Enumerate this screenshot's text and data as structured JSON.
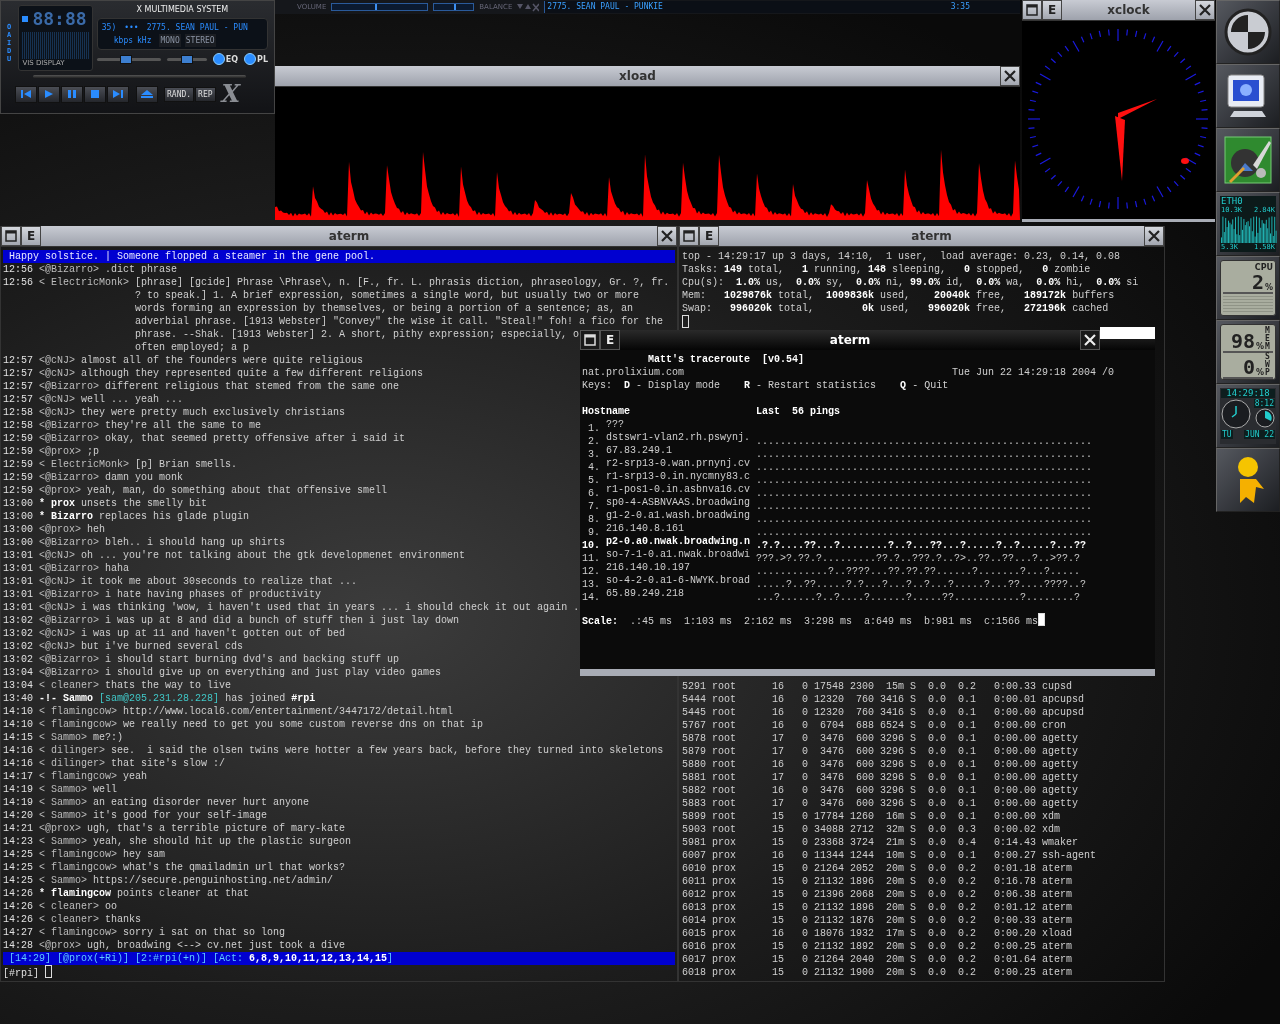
{
  "xmms": {
    "side_label": "OAIDU",
    "time": "88:88",
    "vis_label": "VIS DISPLAY",
    "title": "X MULTIMEDIA SYSTEM",
    "track_number": "35)",
    "dots": "•••",
    "track": "2775. SEAN PAUL - PUN",
    "bitrate_unit": "kbps",
    "rate_unit": "kHz",
    "modes": [
      {
        "label": "MONO",
        "on": false
      },
      {
        "label": "STEREO",
        "on": false
      }
    ],
    "volume": {
      "level": 0.45
    },
    "balance": {
      "level": 0.5
    },
    "toggles": [
      {
        "label": "EQ",
        "on": true
      },
      {
        "label": "PL",
        "on": true
      }
    ],
    "controls": [
      {
        "kind": "previous"
      },
      {
        "kind": "play"
      },
      {
        "kind": "pause"
      },
      {
        "kind": "stop"
      },
      {
        "kind": "next"
      },
      {
        "kind": "eject"
      }
    ],
    "options": [
      {
        "label": "RAND."
      },
      {
        "label": "REP"
      }
    ],
    "logo": "X"
  },
  "playlist_bar": {
    "volume_label": "VOLUME",
    "volume": {
      "level": 0.45
    },
    "balance_label": "BALANCE",
    "balance": {
      "level": 0.5
    },
    "track": "2775. SEAN PAUL - PUNKIE",
    "time": "3:35"
  },
  "xload": {
    "title": "xload"
  },
  "xclock": {
    "title": "xclock",
    "e_button": "E",
    "focused": false
  },
  "dock": [
    {
      "kind": "logo"
    },
    {
      "kind": "monitor"
    },
    {
      "kind": "paint"
    },
    {
      "kind": "network",
      "interface": "ETH0",
      "top_in": "10.3K",
      "top_out": "2.84K",
      "bottom_in": "5.3K",
      "bottom_out": "1.58K"
    },
    {
      "kind": "cpu",
      "label": "CPU",
      "value": "2",
      "unit": "%"
    },
    {
      "kind": "memory",
      "rows": [
        {
          "label": "MEM",
          "value": "98",
          "unit": "%"
        },
        {
          "label": "SWP",
          "value": "0",
          "unit": "%"
        }
      ]
    },
    {
      "kind": "clock",
      "time": "14:29:18",
      "small": "8:12",
      "day": "TU",
      "date": "JUN 22"
    },
    {
      "kind": "person"
    }
  ],
  "irc": {
    "title": "aterm",
    "e_button": "E",
    "focused": false,
    "topic": "Happy solstice. | Someone flopped a steamer in the gene pool.",
    "lines": [
      {
        "kind": "msg",
        "time": "12:56",
        "nick": "<@Bizarro>",
        "text": ".dict phrase"
      },
      {
        "kind": "msg",
        "time": "12:56",
        "nick": "< ElectricMonk>",
        "text": "[phrase] [gcide] Phrase \\Phrase\\, n. [F., fr. L. phrasis diction, phraseology, Gr. ?, fr."
      },
      {
        "kind": "cont",
        "text": "? to speak.] 1. A brief expression, sometimes a single word, but usually two or more"
      },
      {
        "kind": "cont",
        "text": "words forming an expression by themselves, or being a portion of a sentence; as, an"
      },
      {
        "kind": "cont",
        "text": "adverbial phrase. [1913 Webster] \"Convey\" the wise it call. \"Steal!\" foh! a fico for the"
      },
      {
        "kind": "cont",
        "text": "phrase. --Shak. [1913 Webster] 2. A short, pithy expression; especially, o"
      },
      {
        "kind": "cont",
        "text": "often employed; a p"
      },
      {
        "kind": "msg",
        "time": "12:57",
        "nick": "<@cNJ>",
        "text": "almost all of the founders were quite religious"
      },
      {
        "kind": "msg",
        "time": "12:57",
        "nick": "<@cNJ>",
        "text": "although they represented quite a few different religions"
      },
      {
        "kind": "msg",
        "time": "12:57",
        "nick": "<@Bizarro>",
        "text": "different religious that stemed from the same one"
      },
      {
        "kind": "msg",
        "time": "12:57",
        "nick": "<@cNJ>",
        "text": "well ... yeah ..."
      },
      {
        "kind": "msg",
        "time": "12:58",
        "nick": "<@cNJ>",
        "text": "they were pretty much exclusively christians"
      },
      {
        "kind": "msg",
        "time": "12:58",
        "nick": "<@Bizarro>",
        "text": "they're all the same to me"
      },
      {
        "kind": "msg",
        "time": "12:59",
        "nick": "<@Bizarro>",
        "text": "okay, that seemed pretty offensive after i said it"
      },
      {
        "kind": "msg",
        "time": "12:59",
        "nick": "<@prox>",
        "text": ";p"
      },
      {
        "kind": "msg",
        "time": "12:59",
        "nick": "< ElectricMonk>",
        "text": "[p] Brian smells."
      },
      {
        "kind": "msg",
        "time": "12:59",
        "nick": "<@Bizarro>",
        "text": "damn you monk"
      },
      {
        "kind": "msg",
        "time": "12:59",
        "nick": "<@prox>",
        "text": "yeah, man, do something about that offensive smell"
      },
      {
        "kind": "action",
        "time": "13:00",
        "marker": "*",
        "nick": "prox",
        "text": "unsets the smelly bit"
      },
      {
        "kind": "action",
        "time": "13:00",
        "marker": "*",
        "nick": "Bizarro",
        "text": "replaces his glade plugin"
      },
      {
        "kind": "msg",
        "time": "13:00",
        "nick": "<@prox>",
        "text": "heh"
      },
      {
        "kind": "msg",
        "time": "13:00",
        "nick": "<@Bizarro>",
        "text": "bleh.. i should hang up shirts"
      },
      {
        "kind": "msg",
        "time": "13:01",
        "nick": "<@cNJ>",
        "text": "oh ... you're not talking about the gtk developmenet environment"
      },
      {
        "kind": "msg",
        "time": "13:01",
        "nick": "<@Bizarro>",
        "text": "haha"
      },
      {
        "kind": "msg",
        "time": "13:01",
        "nick": "<@cNJ>",
        "text": "it took me about 30seconds to realize that ..."
      },
      {
        "kind": "msg",
        "time": "13:01",
        "nick": "<@Bizarro>",
        "text": "i hate having phases of productivity"
      },
      {
        "kind": "msg",
        "time": "13:01",
        "nick": "<@cNJ>",
        "text": "i was thinking 'wow, i haven't used that in years ... i should check it out again ."
      },
      {
        "kind": "msg",
        "time": "13:02",
        "nick": "<@Bizarro>",
        "text": "i was up at 8 and did a bunch of stuff then i just lay down"
      },
      {
        "kind": "msg",
        "time": "13:02",
        "nick": "<@cNJ>",
        "text": "i was up at 11 and haven't gotten out of bed"
      },
      {
        "kind": "msg",
        "time": "13:02",
        "nick": "<@cNJ>",
        "text": "but i've burned several cds"
      },
      {
        "kind": "msg",
        "time": "13:02",
        "nick": "<@Bizarro>",
        "text": "i should start burning dvd's and backing stuff up"
      },
      {
        "kind": "msg",
        "time": "13:04",
        "nick": "<@Bizarro>",
        "text": "i should give up on everything and just play video games"
      },
      {
        "kind": "msg",
        "time": "13:04",
        "nick": "< cleaner>",
        "text": "thats the way to live"
      },
      {
        "kind": "join",
        "time": "13:40",
        "marker": "-!-",
        "nick": "Sammo",
        "host": "[sam@205.231.28.228]",
        "text": "has joined",
        "channel": "#rpi"
      },
      {
        "kind": "msg",
        "time": "14:10",
        "nick": "< flamingcow>",
        "text": "http://www.local6.com/entertainment/3447172/detail.html"
      },
      {
        "kind": "msg",
        "time": "14:10",
        "nick": "< flamingcow>",
        "text": "we really need to get you some custom reverse dns on that ip"
      },
      {
        "kind": "msg",
        "time": "14:15",
        "nick": "< Sammo>",
        "text": "me?:)"
      },
      {
        "kind": "msg",
        "time": "14:16",
        "nick": "< dilinger>",
        "text": "see.  i said the olsen twins were hotter a few years back, before they turned into skeletons"
      },
      {
        "kind": "msg",
        "time": "14:16",
        "nick": "< dilinger>",
        "text": "that site's slow :/"
      },
      {
        "kind": "msg",
        "time": "14:17",
        "nick": "< flamingcow>",
        "text": "yeah"
      },
      {
        "kind": "msg",
        "time": "14:19",
        "nick": "< Sammo>",
        "text": "well"
      },
      {
        "kind": "msg",
        "time": "14:19",
        "nick": "< Sammo>",
        "text": "an eating disorder never hurt anyone"
      },
      {
        "kind": "msg",
        "time": "14:20",
        "nick": "< Sammo>",
        "text": "it's good for your self-image"
      },
      {
        "kind": "msg",
        "time": "14:21",
        "nick": "<@prox>",
        "text": "ugh, that's a terrible picture of mary-kate"
      },
      {
        "kind": "msg",
        "time": "14:23",
        "nick": "< Sammo>",
        "text": "yeah, she should hit up the plastic surgeon"
      },
      {
        "kind": "msg",
        "time": "14:25",
        "nick": "< flamingcow>",
        "text": "hey sam"
      },
      {
        "kind": "msg",
        "time": "14:25",
        "nick": "< flamingcow>",
        "text": "what's the qmailadmin url that works?"
      },
      {
        "kind": "msg",
        "time": "14:25",
        "nick": "< Sammo>",
        "text": "https://secure.penguinhosting.net/admin/"
      },
      {
        "kind": "action",
        "time": "14:26",
        "marker": "*",
        "nick": "flamingcow",
        "text": "points cleaner at that"
      },
      {
        "kind": "msg",
        "time": "14:26",
        "nick": "< cleaner>",
        "text": "oo"
      },
      {
        "kind": "msg",
        "time": "14:26",
        "nick": "< cleaner>",
        "text": "thanks"
      },
      {
        "kind": "msg",
        "time": "14:27",
        "nick": "< flamingcow>",
        "text": "sorry i sat on that so long"
      },
      {
        "kind": "msg",
        "time": "14:28",
        "nick": "<@prox>",
        "text": "ugh, broadwing <--> cv.net just took a dive"
      }
    ],
    "status": "[14:29] [@prox(+Ri)] [2:#rpi(+n)] [Act: **6,8,9,10,11,12,13,14,15**]",
    "prompt": "[#rpi]"
  },
  "top": {
    "title": "aterm",
    "e_button": "E",
    "focused": false,
    "header": [
      "top - 14:29:17 up 3 days, 14:10,  1 user,  load average: 0.23, 0.14, 0.08",
      "Tasks: **149** total,   **1** running, **148** sleeping,   **0** stopped,   **0** zombie",
      "Cpu(s):  **1.0%** us,  **0.0%** sy,  **0.0%** ni, **99.0%** id,  **0.0%** wa,  **0.0%** hi,  **0.0%** si",
      "Mem:   **1029876k** total,  **1009836k** used,    **20040k** free,   **189172k** buffers",
      "Swap:   **996020k** total,        **0k** used,   **996020k** free,   **272196k** cached"
    ],
    "processes": [
      "5291 root      16   0 17548 2300  15m S  0.0  0.2   0:00.33 cupsd",
      "5444 root      16   0 12320  760 3416 S  0.0  0.1   0:00.01 apcupsd",
      "5445 root      16   0 12320  760 3416 S  0.0  0.1   0:00.00 apcupsd",
      "5767 root      16   0  6704  688 6524 S  0.0  0.1   0:00.00 cron",
      "5878 root      17   0  3476  600 3296 S  0.0  0.1   0:00.00 agetty",
      "5879 root      17   0  3476  600 3296 S  0.0  0.1   0:00.00 agetty",
      "5880 root      16   0  3476  600 3296 S  0.0  0.1   0:00.00 agetty",
      "5881 root      17   0  3476  600 3296 S  0.0  0.1   0:00.00 agetty",
      "5882 root      16   0  3476  600 3296 S  0.0  0.1   0:00.00 agetty",
      "5883 root      17   0  3476  600 3296 S  0.0  0.1   0:00.00 agetty",
      "5899 root      15   0 17784 1260  16m S  0.0  0.1   0:00.00 xdm",
      "5903 root      15   0 34088 2712  32m S  0.0  0.3   0:00.02 xdm",
      "5981 prox      15   0 23368 3724  21m S  0.0  0.4   0:14.43 wmaker",
      "6007 prox      16   0 11344 1244  10m S  0.0  0.1   0:00.27 ssh-agent",
      "6010 prox      15   0 21264 2052  20m S  0.0  0.2   0:01.18 aterm",
      "6011 prox      15   0 21132 1896  20m S  0.0  0.2   0:16.78 aterm",
      "6012 prox      15   0 21396 2068  20m S  0.0  0.2   0:06.38 aterm",
      "6013 prox      15   0 21132 1896  20m S  0.0  0.2   0:01.12 aterm",
      "6014 prox      15   0 21132 1876  20m S  0.0  0.2   0:00.33 aterm",
      "6015 prox      16   0 18076 1932  17m S  0.0  0.2   0:00.20 xload",
      "6016 prox      15   0 21132 1892  20m S  0.0  0.2   0:00.25 aterm",
      "6017 prox      15   0 21264 2040  20m S  0.0  0.2   0:01.64 aterm",
      "6018 prox      15   0 21132 1900  20m S  0.0  0.2   0:00.25 aterm"
    ]
  },
  "traceroute": {
    "title": "aterm",
    "e_button": "E",
    "focused": true,
    "heading": "Matt's traceroute  [v0.54]",
    "host": "nat.prolixium.com",
    "datetime": "Tue Jun 22 14:29:18 2004 /0",
    "keys": "Keys:  **D** - Display mode    **R** - Restart statistics    **Q** - Quit",
    "host_column": "Hostname",
    "pings_column": "Last  56 pings",
    "hops": [
      {
        "number": "1.",
        "host": "???",
        "highlighted": false
      },
      {
        "number": "2.",
        "host": "dstswr1-vlan2.rh.pswynj.",
        "pings": "........................................................",
        "highlighted": false
      },
      {
        "number": "3.",
        "host": "67.83.249.1",
        "pings": "........................................................",
        "highlighted": false
      },
      {
        "number": "4.",
        "host": "r2-srp13-0.wan.prnynj.cv",
        "pings": "........................................................",
        "highlighted": false
      },
      {
        "number": "5.",
        "host": "r1-srp13-0.in.nycmny83.c",
        "pings": "........................................................",
        "highlighted": false
      },
      {
        "number": "6.",
        "host": "r1-pos1-0.in.asbnva16.cv",
        "pings": "........................................................",
        "highlighted": false
      },
      {
        "number": "7.",
        "host": "sp0-4-ASBNVAAS.broadwing",
        "pings": "........................................................",
        "highlighted": false
      },
      {
        "number": "8.",
        "host": "g1-2-0.a1.wash.broadwing",
        "pings": "........................................................",
        "highlighted": false
      },
      {
        "number": "9.",
        "host": "216.140.8.161",
        "pings": "........................................................",
        "highlighted": false
      },
      {
        "number": "10.",
        "host": "p2-0.a0.nwak.broadwing.n",
        "pings": ".?.?....??...?........?..?...??...?.....?..?.....?...??",
        "highlighted": true
      },
      {
        "number": "11.",
        "host": "so-7-1-0.a1.nwak.broadwi",
        "pings": "???.>?.??.?.........??.?..???.?..?>..??..??...?..>??.?",
        "highlighted": false
      },
      {
        "number": "12.",
        "host": "216.140.10.197",
        "pings": "............?..????...??.??.??......?.......?...?.....",
        "highlighted": false
      },
      {
        "number": "13.",
        "host": "so-4-2-0.a1-6-NWYK.broad",
        "pings": ".....?..??.....?.?...?...?..?...?.....?...??....????..?",
        "highlighted": false
      },
      {
        "number": "14.",
        "host": "65.89.249.218",
        "pings": "...?......?..?....?......?.....??...........?........?",
        "highlighted": false
      }
    ],
    "scale": "**Scale:**  .:45 ms  1:103 ms  2:162 ms  3:298 ms  a:649 ms  b:981 ms  c:1566 ms"
  }
}
